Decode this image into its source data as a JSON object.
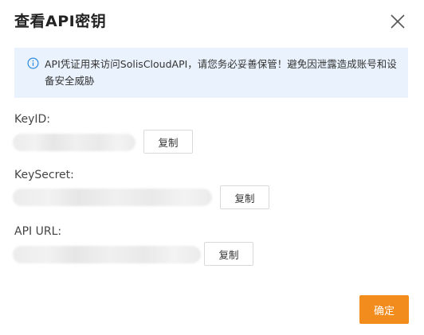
{
  "dialog": {
    "title": "查看API密钥",
    "close_icon": "close-icon"
  },
  "notice": {
    "icon": "info-icon",
    "text": "API凭证用来访问SolisCloudAPI，请您务必妥善保管！避免因泄露造成账号和设备安全威胁"
  },
  "fields": {
    "key_id": {
      "label": "KeyID:",
      "copy_label": "复制"
    },
    "key_secret": {
      "label": "KeySecret:",
      "copy_label": "复制"
    },
    "api_url": {
      "label": "API URL:",
      "copy_label": "复制"
    }
  },
  "footer": {
    "confirm_label": "确定"
  },
  "colors": {
    "accent": "#f28c1d",
    "notice_bg": "#eaf3fd",
    "info_icon": "#2f8be6"
  }
}
